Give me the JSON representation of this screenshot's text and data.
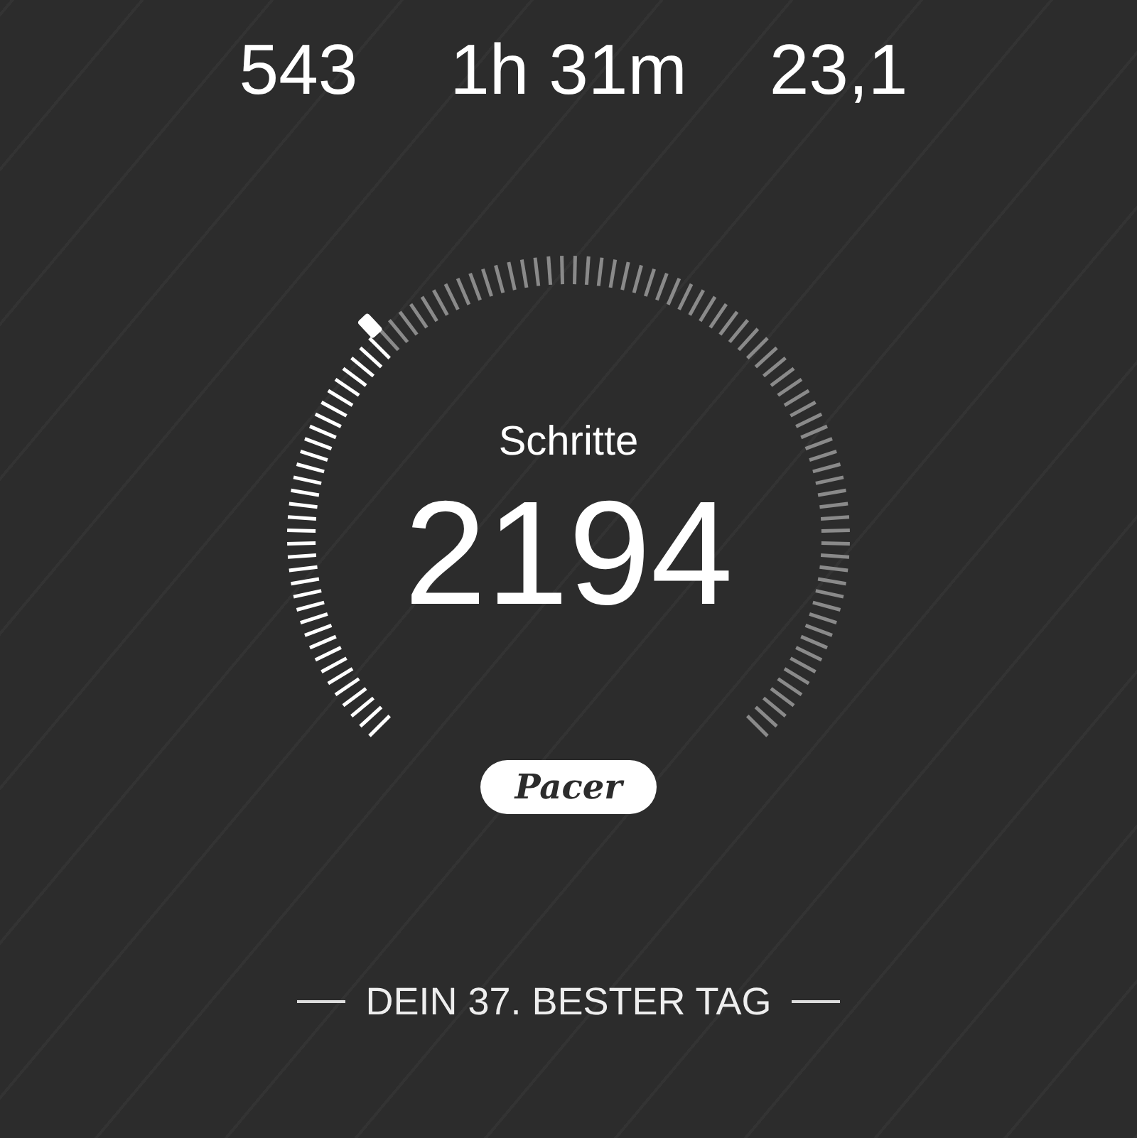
{
  "stats": [
    {
      "value": "543"
    },
    {
      "value": "1h 31m"
    },
    {
      "value": "23,1"
    }
  ],
  "steps_gauge": {
    "label": "Schritte",
    "value": "2194"
  },
  "logo": {
    "text": "Pacer"
  },
  "footer": {
    "text": "DEIN 37. BESTER TAG"
  }
}
